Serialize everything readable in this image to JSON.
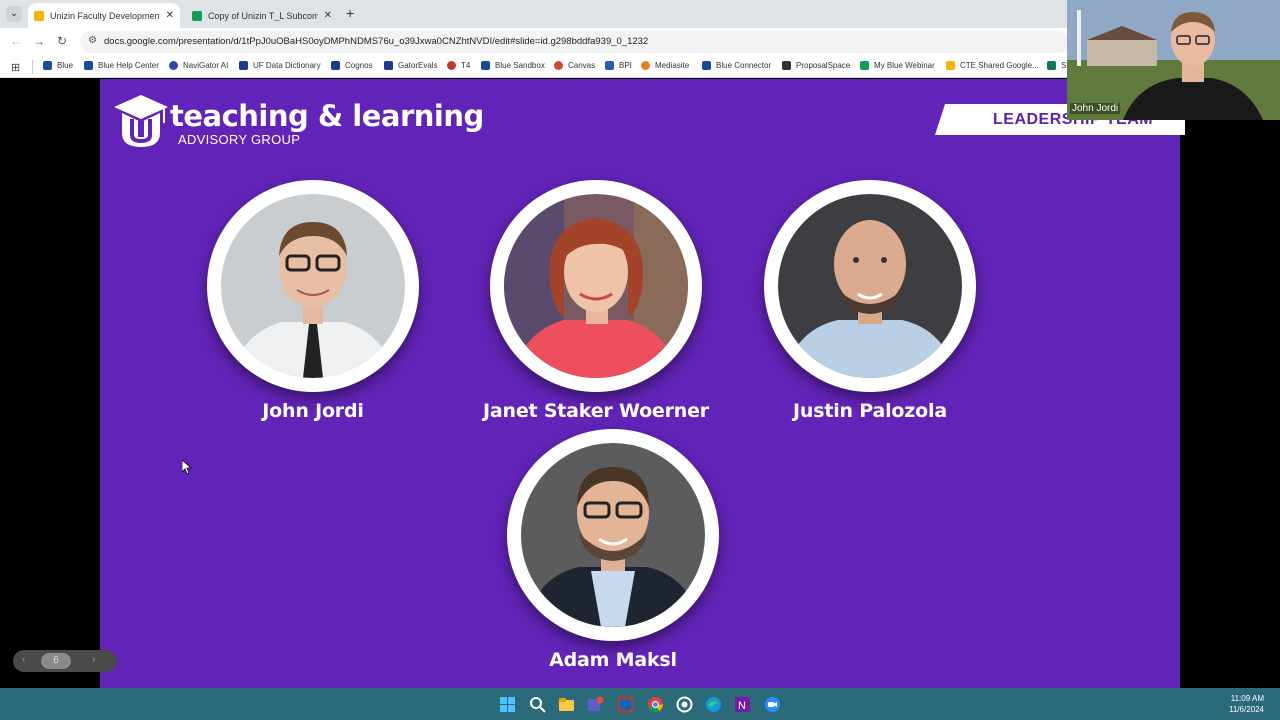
{
  "browser": {
    "tabs": [
      {
        "title": "Unizin Faculty Development Su",
        "favicon_color": "#f4b400",
        "active": true
      },
      {
        "title": "Copy of Unizin T_L Subcommitt",
        "favicon_color": "#0f9d58",
        "active": false
      }
    ],
    "new_tab": "+",
    "url": "docs.google.com/presentation/d/1tPpJ0uOBaHS0oyDMPhNDMS76u_o39Jxwa0CNZhtNVDI/edit#slide=id.g298bddfa939_0_1232",
    "bookmarks": [
      {
        "label": "Blue",
        "color": "#1a4b9c"
      },
      {
        "label": "Blue Help Center",
        "color": "#1a4b9c"
      },
      {
        "label": "NaviGator AI",
        "color": "#2e47a8"
      },
      {
        "label": "UF Data Dictionary",
        "color": "#1b3b8f"
      },
      {
        "label": "Cognos",
        "color": "#1b3b8f"
      },
      {
        "label": "GatorEvals",
        "color": "#1b3b8f"
      },
      {
        "label": "T4",
        "color": "#c0392b"
      },
      {
        "label": "Blue Sandbox",
        "color": "#1a4b9c"
      },
      {
        "label": "Canvas",
        "color": "#d64531"
      },
      {
        "label": "BPI",
        "color": "#2a5caa"
      },
      {
        "label": "Mediasite",
        "color": "#e67e22"
      },
      {
        "label": "Blue Connector",
        "color": "#1a4b9c"
      },
      {
        "label": "ProposalSpace",
        "color": "#333333"
      },
      {
        "label": "My Blue Webinar",
        "color": "#0f9d58"
      },
      {
        "label": "CTE Shared Google...",
        "color": "#f4b400"
      },
      {
        "label": "S",
        "color": "#0f7a5a"
      }
    ]
  },
  "slide": {
    "logo_title": "teaching & learning",
    "logo_subtitle": "ADVISORY GROUP",
    "banner": "LEADERSHIP TEAM",
    "members": [
      {
        "name": "John Jordi"
      },
      {
        "name": "Janet Staker Woerner"
      },
      {
        "name": "Justin Palozola"
      },
      {
        "name": "Adam Maksl"
      }
    ],
    "background_color": "#6224b8"
  },
  "slide_nav": {
    "prev": "‹",
    "page": "6",
    "next": "›"
  },
  "webcam": {
    "participant": "John Jordi"
  },
  "taskbar": {
    "icons": [
      "windows-start",
      "search",
      "file-explorer",
      "teams",
      "outlook",
      "chrome",
      "app",
      "edge",
      "onenote",
      "zoom"
    ],
    "time": "11:09 AM",
    "date": "11/6/2024"
  }
}
